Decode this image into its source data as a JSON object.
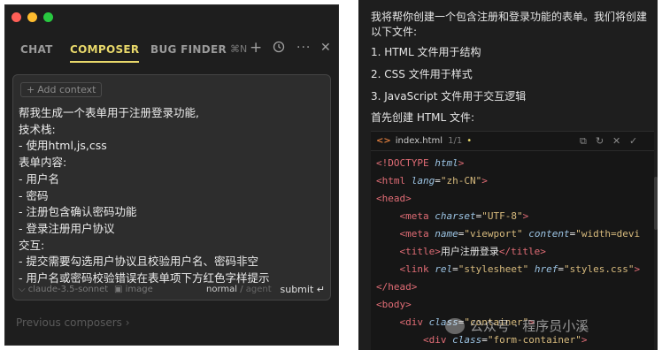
{
  "left": {
    "tabs": [
      "CHAT",
      "COMPOSER",
      "BUG FINDER"
    ],
    "active_tab": "COMPOSER",
    "shortcut": "⌘N",
    "add_context": "Add context",
    "prompt_lines": [
      "帮我生成一个表单用于注册登录功能,",
      "技术栈:",
      "- 使用html,js,css",
      "表单内容:",
      "- 用户名",
      "- 密码",
      "- 注册包含确认密码功能",
      "- 登录注册用户协议",
      "交互:",
      "- 提交需要勾选用户协议且校验用户名、密码非空",
      "- 用户名或密码校验错误在表单项下方红色字样提示"
    ],
    "model": "claude-3.5-sonnet",
    "image_label": "image",
    "mode_normal": "normal",
    "mode_sep": "/",
    "mode_agent": "agent",
    "submit_label": "submit",
    "previous_composers": "Previous composers"
  },
  "right": {
    "intro_line1": "我将帮你创建一个包含注册和登录功能的表单。我们将创建",
    "intro_line2": "以下文件:",
    "list": [
      "1. HTML 文件用于结构",
      "2. CSS 文件用于样式",
      "3. JavaScript 文件用于交互逻辑"
    ],
    "lead": "首先创建 HTML 文件:",
    "file": {
      "name": "index.html",
      "pager": "1/1",
      "modified": "•"
    },
    "code_lines": [
      [
        {
          "t": "tg",
          "v": "<!DOCTYPE "
        },
        {
          "t": "at",
          "v": "html"
        },
        {
          "t": "tg",
          "v": ">"
        }
      ],
      [
        {
          "t": "tg",
          "v": "<html "
        },
        {
          "t": "at",
          "v": "lang"
        },
        {
          "t": "tx",
          "v": "="
        },
        {
          "t": "st",
          "v": "\"zh-CN\""
        },
        {
          "t": "tg",
          "v": ">"
        }
      ],
      [
        {
          "t": "tg",
          "v": "<head>"
        }
      ],
      [
        {
          "t": "tx",
          "v": "    "
        },
        {
          "t": "tg",
          "v": "<meta "
        },
        {
          "t": "at",
          "v": "charset"
        },
        {
          "t": "tx",
          "v": "="
        },
        {
          "t": "st",
          "v": "\"UTF-8\""
        },
        {
          "t": "tg",
          "v": ">"
        }
      ],
      [
        {
          "t": "tx",
          "v": "    "
        },
        {
          "t": "tg",
          "v": "<meta "
        },
        {
          "t": "at",
          "v": "name"
        },
        {
          "t": "tx",
          "v": "="
        },
        {
          "t": "st",
          "v": "\"viewport\""
        },
        {
          "t": "tx",
          "v": " "
        },
        {
          "t": "at",
          "v": "content"
        },
        {
          "t": "tx",
          "v": "="
        },
        {
          "t": "st",
          "v": "\"width=devi"
        }
      ],
      [
        {
          "t": "tx",
          "v": "    "
        },
        {
          "t": "tg",
          "v": "<title>"
        },
        {
          "t": "tx",
          "v": "用户注册登录"
        },
        {
          "t": "tg",
          "v": "</title>"
        }
      ],
      [
        {
          "t": "tx",
          "v": "    "
        },
        {
          "t": "tg",
          "v": "<link "
        },
        {
          "t": "at",
          "v": "rel"
        },
        {
          "t": "tx",
          "v": "="
        },
        {
          "t": "st",
          "v": "\"stylesheet\""
        },
        {
          "t": "tx",
          "v": " "
        },
        {
          "t": "at",
          "v": "href"
        },
        {
          "t": "tx",
          "v": "="
        },
        {
          "t": "st",
          "v": "\"styles.css\""
        },
        {
          "t": "tg",
          "v": ">"
        }
      ],
      [
        {
          "t": "tg",
          "v": "</head>"
        }
      ],
      [
        {
          "t": "tg",
          "v": "<body>"
        }
      ],
      [
        {
          "t": "tx",
          "v": "    "
        },
        {
          "t": "tg",
          "v": "<div "
        },
        {
          "t": "at",
          "v": "class"
        },
        {
          "t": "tx",
          "v": "="
        },
        {
          "t": "st",
          "v": "\"container\""
        },
        {
          "t": "tg",
          "v": ">"
        }
      ],
      [
        {
          "t": "tx",
          "v": "        "
        },
        {
          "t": "tg",
          "v": "<div "
        },
        {
          "t": "at",
          "v": "class"
        },
        {
          "t": "tx",
          "v": "="
        },
        {
          "t": "st",
          "v": "\"form-container\""
        },
        {
          "t": "tg",
          "v": ">"
        }
      ],
      [
        {
          "t": "tx",
          "v": "            "
        },
        {
          "t": "tg",
          "v": "<div "
        },
        {
          "t": "at",
          "v": "class"
        },
        {
          "t": "tx",
          "v": "="
        },
        {
          "t": "st",
          "v": "\"form-"
        }
      ]
    ],
    "watermark": "公众号 · 程序员小溪"
  },
  "colors": {
    "accent": "#e8d86a",
    "traffic_red": "#ff5f57",
    "traffic_yellow": "#febc2e",
    "traffic_green": "#28c840",
    "tag": "#e06c75",
    "attr": "#9cc4e4",
    "string": "#d7ba7d"
  },
  "icons": [
    "plus-icon",
    "history-icon",
    "more-icon",
    "close-icon",
    "copy-icon",
    "refresh-icon",
    "reject-icon",
    "accept-icon",
    "html-file-icon",
    "wechat-icon"
  ]
}
